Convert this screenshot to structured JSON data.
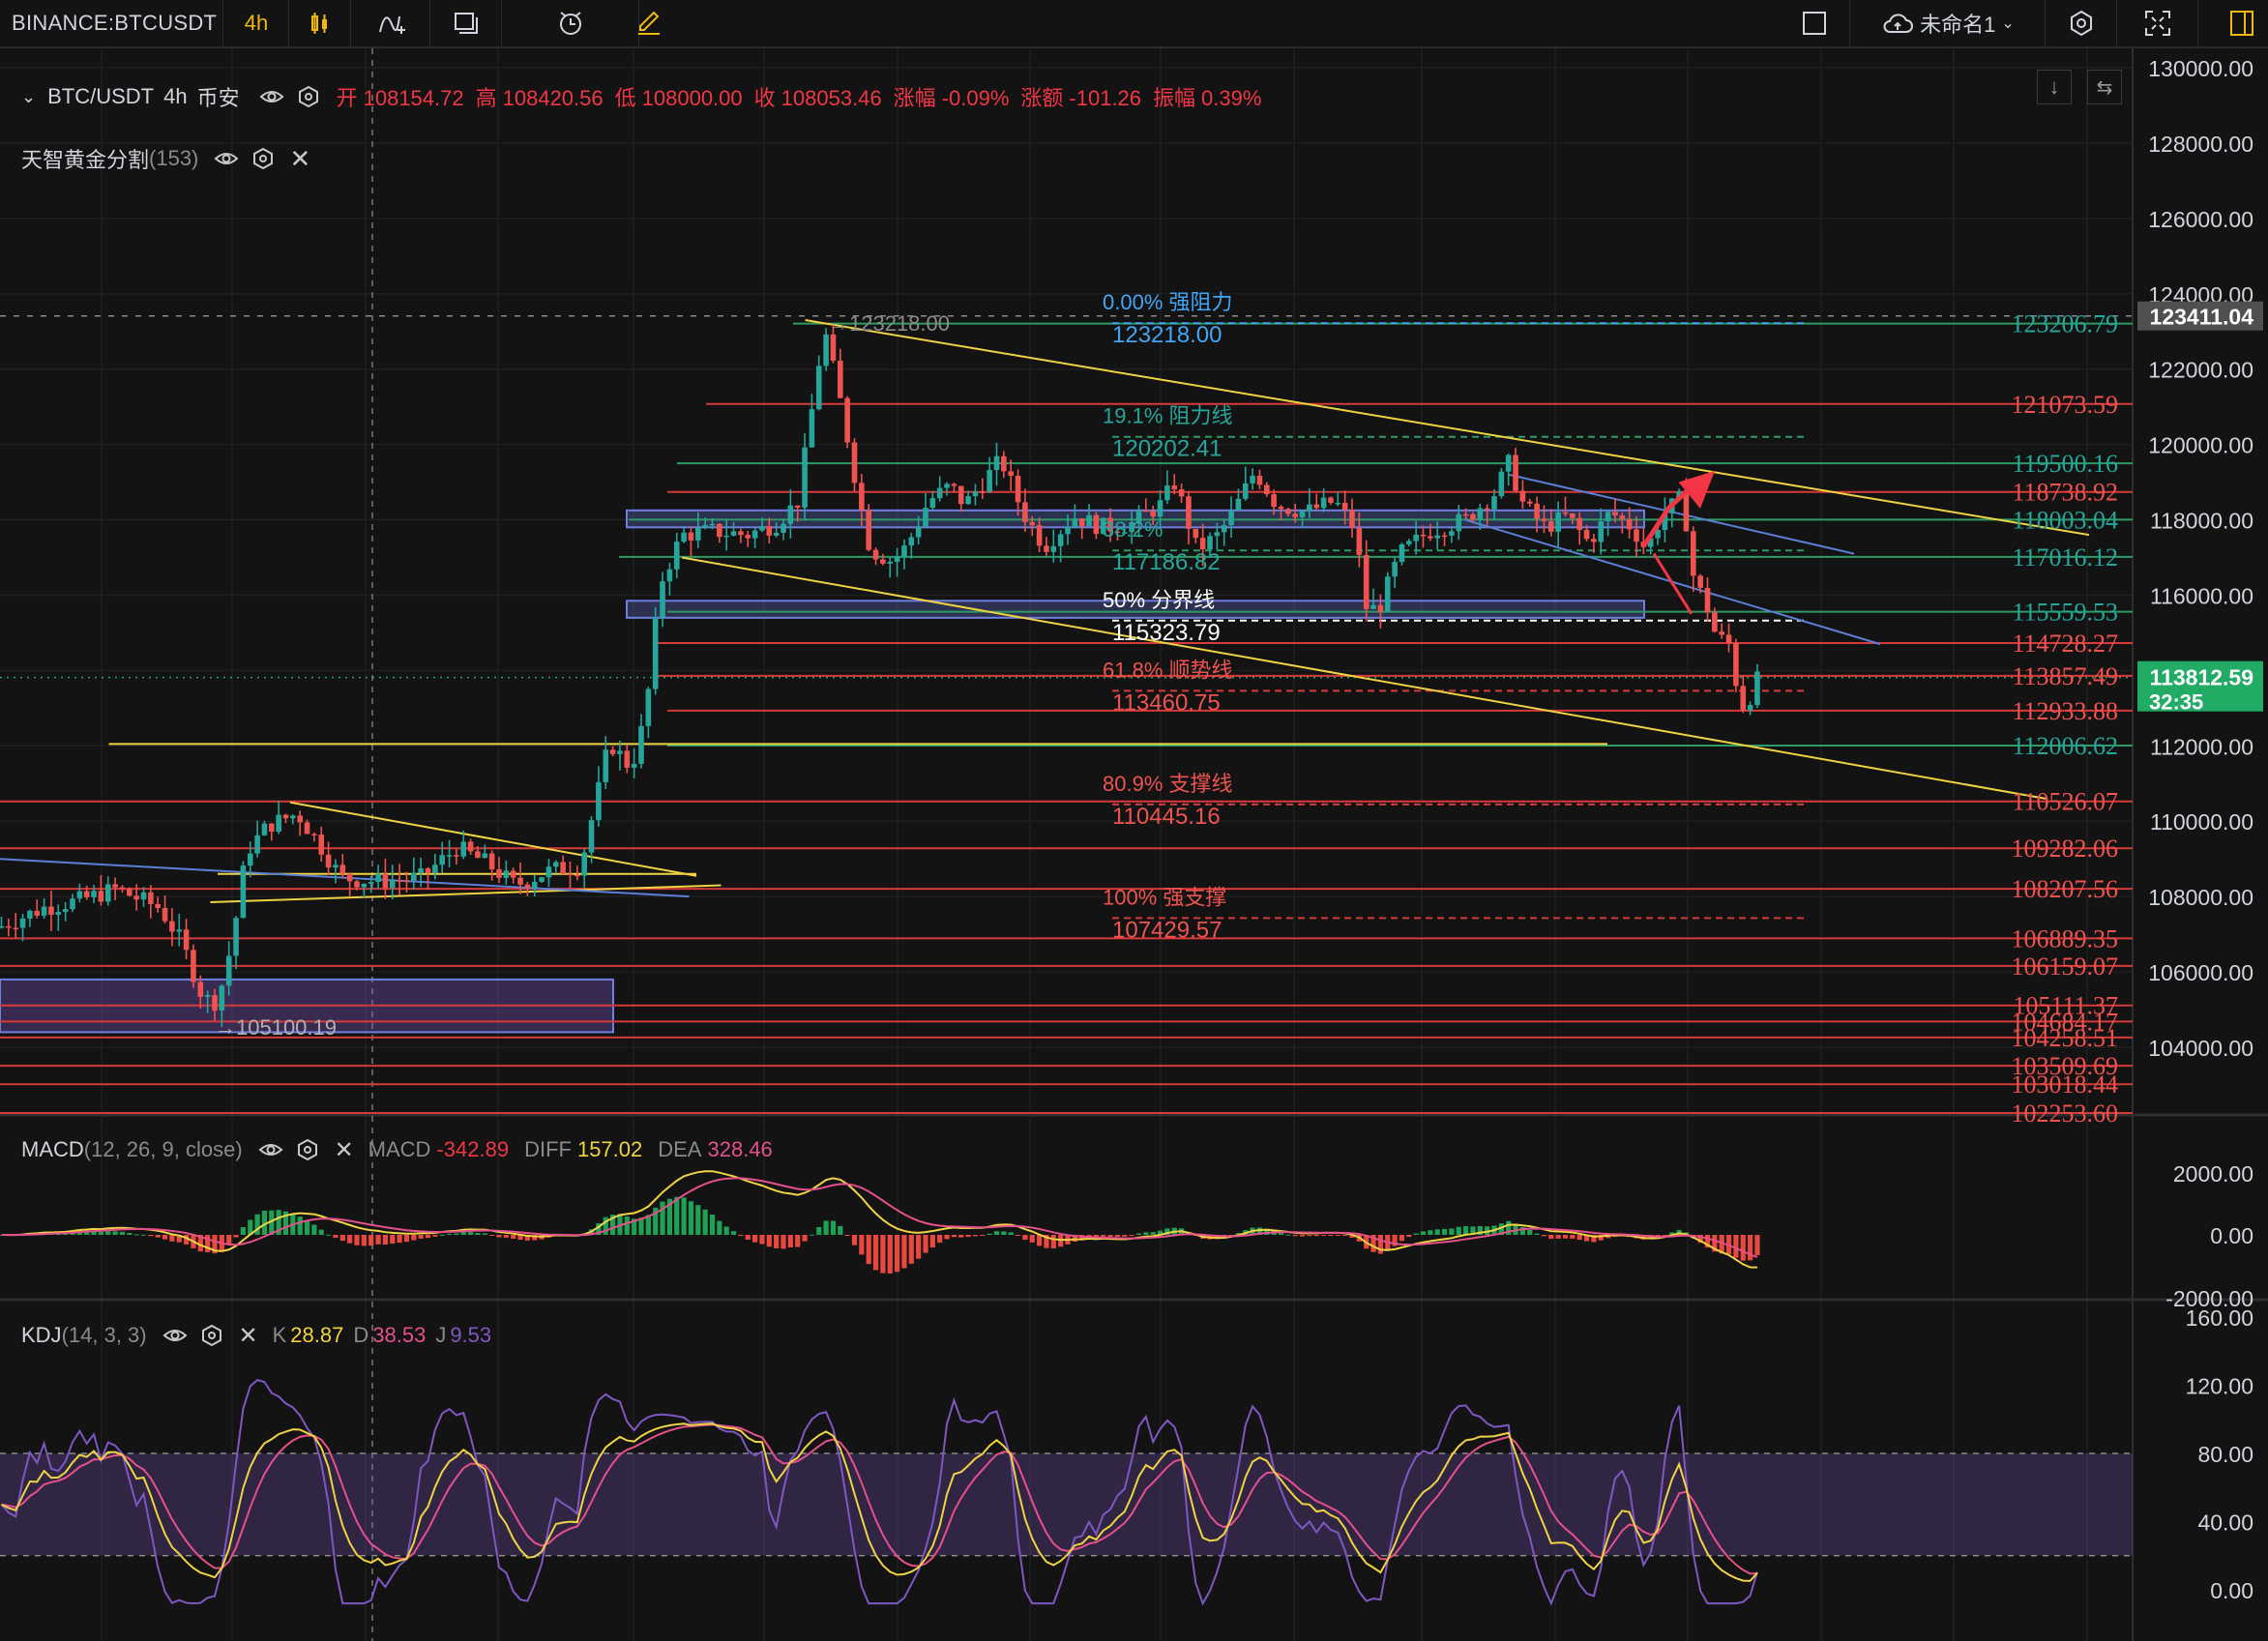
{
  "topbar": {
    "symbol": "BINANCE:BTCUSDT",
    "interval": "4h",
    "layout_name": "未命名1",
    "icons": [
      "candles-icon",
      "indicators-icon",
      "templates-icon",
      "alert-icon",
      "drawing-icon",
      "layout-square-icon",
      "cloud-save-icon",
      "settings-icon",
      "fullscreen-icon",
      "panel-icon"
    ]
  },
  "legend": {
    "title": "BTC/USDT",
    "interval": "4h",
    "exchange": "币安",
    "ohlc": [
      {
        "k": "开",
        "v": "108154.72"
      },
      {
        "k": "高",
        "v": "108420.56"
      },
      {
        "k": "低",
        "v": "108000.00"
      },
      {
        "k": "收",
        "v": "108053.46"
      },
      {
        "k": "涨幅",
        "v": "-0.09%"
      },
      {
        "k": "涨额",
        "v": "-101.26"
      },
      {
        "k": "振幅",
        "v": "0.39%"
      }
    ],
    "indicator_name": "天智黄金分割",
    "indicator_param": "(153)"
  },
  "fib_labels": [
    {
      "text": "0.00% 强阻力",
      "value": "123218.00",
      "color": "#42a5f5"
    },
    {
      "text": "19.1% 阻力线",
      "value": "120202.41",
      "color": "#26a69a"
    },
    {
      "text": "38.2%",
      "value": "117186.82",
      "color": "#26a69a"
    },
    {
      "text": "50% 分界线",
      "value": "115323.79",
      "color": "#ffffff"
    },
    {
      "text": "61.8% 顺势线",
      "value": "113460.75",
      "color": "#ef5350"
    },
    {
      "text": "80.9% 支撑线",
      "value": "110445.16",
      "color": "#ef5350"
    },
    {
      "text": "100% 强支撑",
      "value": "107429.57",
      "color": "#ef5350"
    }
  ],
  "chart_annotations": [
    {
      "text": "→123218.00",
      "price": 123218.0
    },
    {
      "text": "→105100.19",
      "price": 105100.19
    }
  ],
  "level_labels": [
    {
      "v": "123206.79",
      "color": "#26a69a"
    },
    {
      "v": "121073.59",
      "color": "#ef5350"
    },
    {
      "v": "119500.16",
      "color": "#26a69a"
    },
    {
      "v": "118738.92",
      "color": "#ef5350"
    },
    {
      "v": "118003.04",
      "color": "#26a69a"
    },
    {
      "v": "117016.12",
      "color": "#26a69a"
    },
    {
      "v": "115559.53",
      "color": "#26a69a"
    },
    {
      "v": "114728.27",
      "color": "#ef5350"
    },
    {
      "v": "113857.49",
      "color": "#ef5350"
    },
    {
      "v": "112933.88",
      "color": "#ef5350"
    },
    {
      "v": "112006.62",
      "color": "#26a69a"
    },
    {
      "v": "110526.07",
      "color": "#ef5350"
    },
    {
      "v": "109282.06",
      "color": "#ef5350"
    },
    {
      "v": "108207.56",
      "color": "#ef5350"
    },
    {
      "v": "106889.35",
      "color": "#ef5350"
    },
    {
      "v": "106159.07",
      "color": "#ef5350"
    },
    {
      "v": "105111.37",
      "color": "#ef5350"
    },
    {
      "v": "104684.17",
      "color": "#ef5350"
    },
    {
      "v": "104258.51",
      "color": "#ef5350"
    },
    {
      "v": "103509.69",
      "color": "#ef5350"
    },
    {
      "v": "103018.44",
      "color": "#ef5350"
    },
    {
      "v": "102253.60",
      "color": "#ef5350"
    }
  ],
  "price_axis": [
    "130000.00",
    "128000.00",
    "126000.00",
    "124000.00",
    "122000.00",
    "120000.00",
    "118000.00",
    "116000.00",
    "114000.00",
    "112000.00",
    "110000.00",
    "108000.00",
    "106000.00",
    "104000.00"
  ],
  "price_tags": {
    "high": "123411.04",
    "current": "113812.59",
    "countdown": "32:35"
  },
  "macd": {
    "name": "MACD",
    "params": "(12, 26, 9, close)",
    "macd_label": "MACD",
    "macd_value": "-342.89",
    "diff_label": "DIFF",
    "diff_value": "157.02",
    "dea_label": "DEA",
    "dea_value": "328.46",
    "axis": [
      "2000.00",
      "0.00",
      "-2000.00"
    ]
  },
  "kdj": {
    "name": "KDJ",
    "params": "(14, 3, 3)",
    "k_label": "K",
    "k_value": "28.87",
    "d_label": "D",
    "d_value": "38.53",
    "j_label": "J",
    "j_value": "9.53",
    "axis": [
      "160.00",
      "120.00",
      "80.00",
      "40.00",
      "0.00"
    ]
  },
  "colors": {
    "up": "#26a69a",
    "down": "#ef5350",
    "background": "#131313",
    "accent": "#f0b90b",
    "current_price": "#22ab64"
  },
  "chart_data": {
    "type": "candlestick",
    "symbol": "BTC/USDT",
    "timeframe": "4h",
    "ylim": [
      102000,
      130500
    ],
    "price_path": [
      [
        0,
        107200
      ],
      [
        30,
        107700
      ],
      [
        55,
        107900
      ],
      [
        80,
        108200
      ],
      [
        110,
        107700
      ],
      [
        125,
        106800
      ],
      [
        140,
        105300
      ],
      [
        150,
        105200
      ],
      [
        160,
        106800
      ],
      [
        170,
        109200
      ],
      [
        185,
        109900
      ],
      [
        205,
        110200
      ],
      [
        220,
        109400
      ],
      [
        235,
        108500
      ],
      [
        260,
        108400
      ],
      [
        290,
        108500
      ],
      [
        315,
        109300
      ],
      [
        335,
        108900
      ],
      [
        355,
        108300
      ],
      [
        380,
        108700
      ],
      [
        400,
        108800
      ],
      [
        410,
        110400
      ],
      [
        420,
        112100
      ],
      [
        435,
        111400
      ],
      [
        445,
        112800
      ],
      [
        455,
        116300
      ],
      [
        470,
        117600
      ],
      [
        490,
        117700
      ],
      [
        515,
        117600
      ],
      [
        535,
        117900
      ],
      [
        550,
        118500
      ],
      [
        560,
        121000
      ],
      [
        568,
        123100
      ],
      [
        580,
        121000
      ],
      [
        593,
        118400
      ],
      [
        600,
        117200
      ],
      [
        615,
        116900
      ],
      [
        625,
        117300
      ],
      [
        640,
        118500
      ],
      [
        655,
        118900
      ],
      [
        665,
        118400
      ],
      [
        690,
        119600
      ],
      [
        705,
        118200
      ],
      [
        720,
        117300
      ],
      [
        740,
        118100
      ],
      [
        760,
        117800
      ],
      [
        780,
        117900
      ],
      [
        800,
        118400
      ],
      [
        810,
        119000
      ],
      [
        825,
        117200
      ],
      [
        840,
        117600
      ],
      [
        850,
        118200
      ],
      [
        865,
        119300
      ],
      [
        880,
        118400
      ],
      [
        900,
        118200
      ],
      [
        920,
        118500
      ],
      [
        935,
        117700
      ],
      [
        940,
        115700
      ],
      [
        950,
        115600
      ],
      [
        965,
        117100
      ],
      [
        985,
        117700
      ],
      [
        1010,
        118000
      ],
      [
        1030,
        118700
      ],
      [
        1040,
        119500
      ],
      [
        1050,
        118400
      ],
      [
        1065,
        117800
      ],
      [
        1080,
        118100
      ],
      [
        1095,
        117400
      ],
      [
        1110,
        118200
      ],
      [
        1125,
        117800
      ],
      [
        1135,
        117200
      ],
      [
        1145,
        118100
      ],
      [
        1160,
        118600
      ],
      [
        1168,
        116300
      ],
      [
        1175,
        115900
      ],
      [
        1183,
        114900
      ],
      [
        1192,
        114700
      ],
      [
        1200,
        113000
      ],
      [
        1205,
        113200
      ],
      [
        1212,
        113800
      ]
    ],
    "fib_levels": [
      {
        "pct": "0.00%",
        "price": 123218.0
      },
      {
        "pct": "19.1%",
        "price": 120202.41
      },
      {
        "pct": "38.2%",
        "price": 117186.82
      },
      {
        "pct": "50%",
        "price": 115323.79
      },
      {
        "pct": "61.8%",
        "price": 113460.75
      },
      {
        "pct": "80.9%",
        "price": 110445.16
      },
      {
        "pct": "100%",
        "price": 107429.57
      }
    ],
    "horizontal_levels": [
      123206.79,
      121073.59,
      119500.16,
      118738.92,
      118003.04,
      117016.12,
      115559.53,
      114728.27,
      113857.49,
      112933.88,
      112006.62,
      110526.07,
      109282.06,
      108207.56,
      106889.35,
      106159.07,
      105111.37,
      104684.17,
      104258.51,
      103509.69,
      103018.44,
      102253.6
    ],
    "trendlines": [
      {
        "color": "#f0d343",
        "from": [
          555,
          123300
        ],
        "to": [
          1440,
          117600
        ]
      },
      {
        "color": "#f0d343",
        "from": [
          470,
          117000
        ],
        "to": [
          1410,
          110600
        ]
      },
      {
        "color": "#f0d343",
        "from": [
          75,
          112050
        ],
        "to": [
          1108,
          112050
        ]
      },
      {
        "color": "#f0d343",
        "from": [
          200,
          110500
        ],
        "to": [
          480,
          108550
        ]
      },
      {
        "color": "#f0d343",
        "from": [
          145,
          107850
        ],
        "to": [
          497,
          108300
        ]
      },
      {
        "color": "#f0d343",
        "from": [
          150,
          108600
        ],
        "to": [
          480,
          108600
        ]
      },
      {
        "color": "#5b7fd6",
        "from": [
          0,
          109000
        ],
        "to": [
          475,
          108000
        ]
      },
      {
        "color": "#5b7fd6",
        "from": [
          1040,
          119200
        ],
        "to": [
          1278,
          117100
        ]
      },
      {
        "color": "#5b7fd6",
        "from": [
          1010,
          118000
        ],
        "to": [
          1296,
          114700
        ]
      }
    ],
    "zones": [
      {
        "color": "#5c6bc0",
        "price_top": 118250,
        "price_bottom": 117800
      },
      {
        "color": "#5c6bc0",
        "price_top": 115850,
        "price_bottom": 115400
      },
      {
        "color": "#7e57c2",
        "price_top": 105800,
        "price_bottom": 104400
      }
    ],
    "macd_ylim": [
      -2000,
      2600
    ],
    "kdj_ylim": [
      -5,
      165
    ],
    "kdj_band": [
      20,
      80
    ]
  }
}
